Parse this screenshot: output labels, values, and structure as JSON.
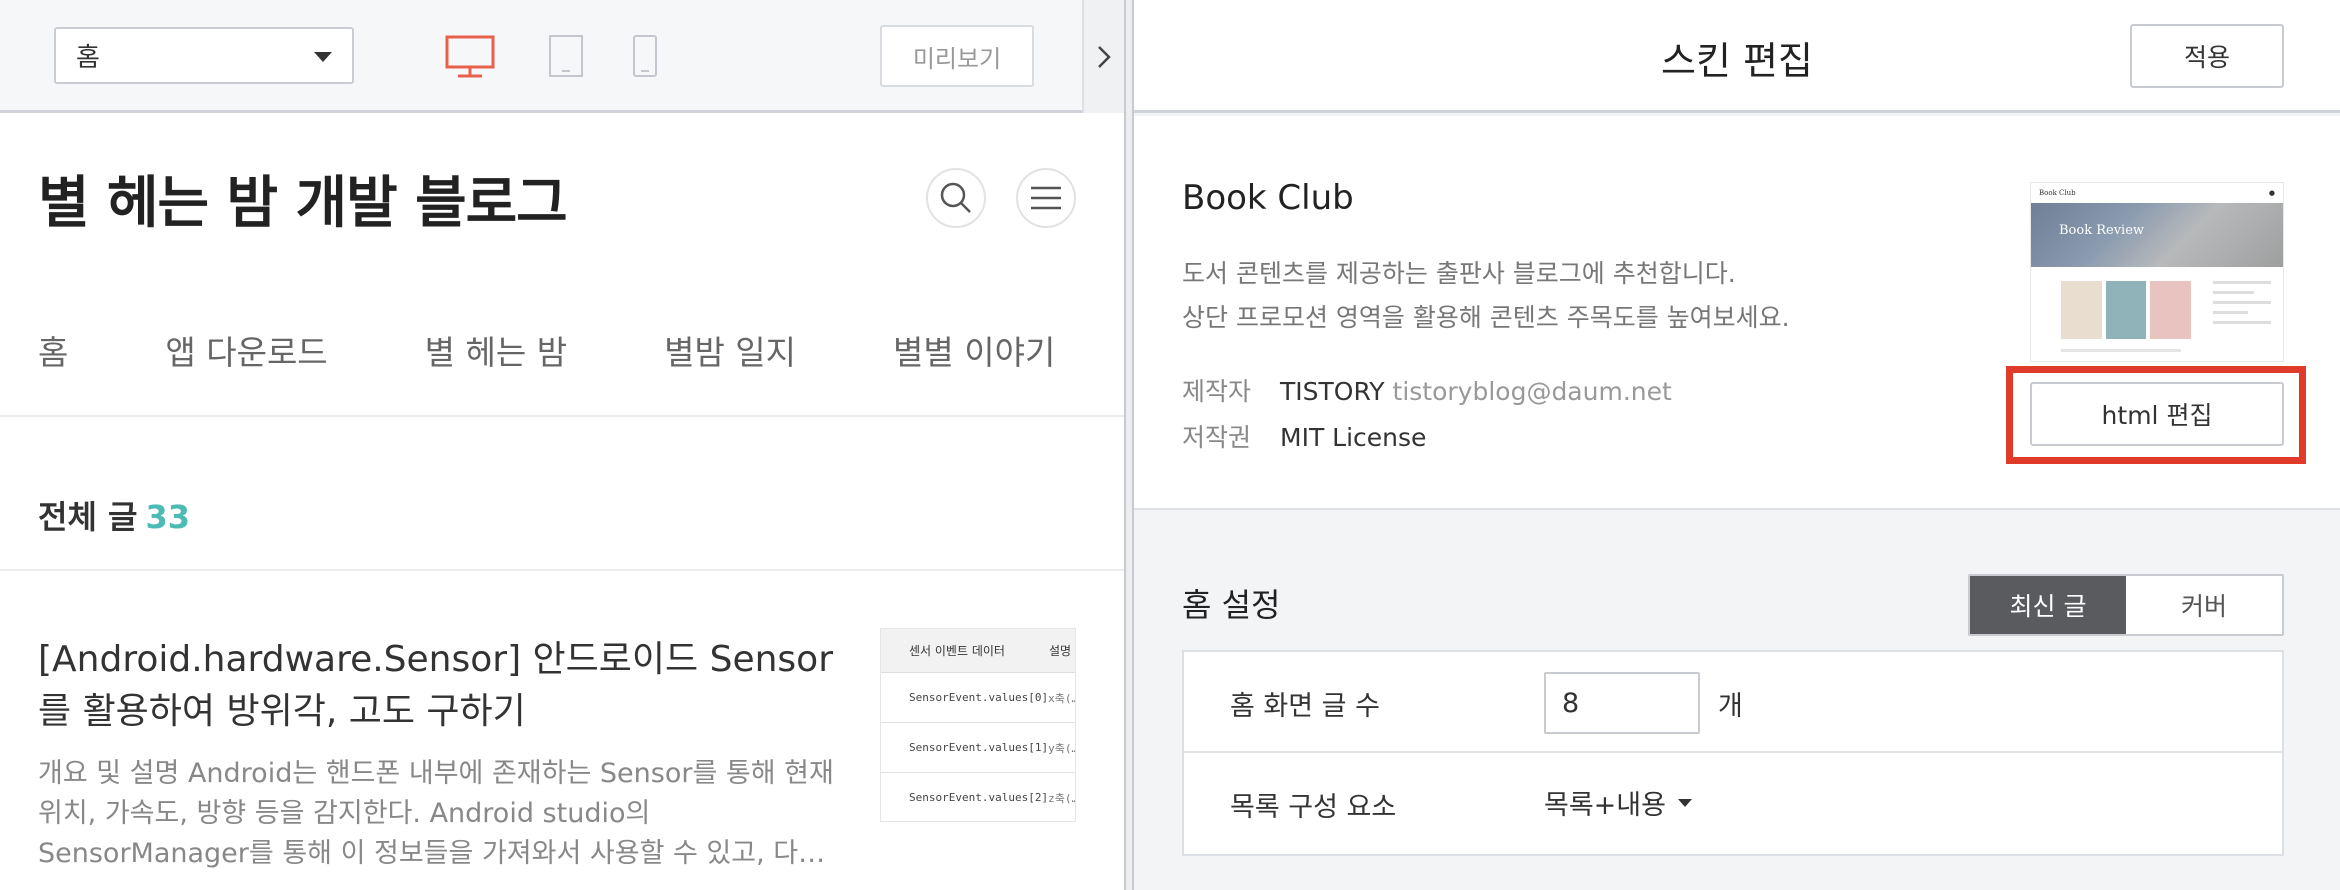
{
  "left": {
    "page_select": "홈",
    "preview_label": "미리보기",
    "blog_title": "별 헤는 밤 개발 블로그",
    "nav": [
      "홈",
      "앱 다운로드",
      "별 헤는 밤",
      "별밤 일지",
      "별별 이야기"
    ],
    "total_label": "전체 글",
    "total_count": "33",
    "post": {
      "title": "[Android.hardware.Sensor] 안드로이드 Sensor를 활용하여 방위각, 고도 구하기",
      "excerpt": "개요 및 설명 Android는 핸드폰 내부에 존재하는 Sensor를 통해 현재 위치, 가속도, 방향 등을 감지한다. Android studio의 SensorManager를 통해 이 정보들을 가져와서 사용할 수 있고, 다…",
      "thumb": {
        "headers": [
          "센서 이벤트 데이터",
          "설명"
        ],
        "rows": [
          {
            "key": "SensorEvent.values[0]",
            "desc": "x축(…"
          },
          {
            "key": "SensorEvent.values[1]",
            "desc": "y축(…"
          },
          {
            "key": "SensorEvent.values[2]",
            "desc": "z축(…"
          }
        ]
      }
    }
  },
  "right": {
    "title": "스킨 편집",
    "apply_label": "적용",
    "skin": {
      "name": "Book Club",
      "desc_line1": "도서 콘텐츠를 제공하는 출판사 블로그에 추천합니다.",
      "desc_line2": "상단 프로모션 영역을 활용해 콘텐츠 주목도를 높여보세요.",
      "maker_label": "제작자",
      "maker": "TISTORY",
      "maker_email": "tistoryblog@daum.net",
      "license_label": "저작권",
      "license": "MIT License",
      "thumb_site": "Book Club",
      "thumb_banner": "Book Review",
      "html_edit_label": "html 편집"
    },
    "home": {
      "label": "홈 설정",
      "tabs": [
        "최신 글",
        "커버"
      ],
      "post_count_label": "홈 화면 글 수",
      "post_count_value": "8",
      "post_count_unit": "개",
      "list_label": "목록 구성 요소",
      "list_value": "목록+내용"
    }
  },
  "colors": {
    "accent_teal": "#4bbbb4",
    "highlight_red": "#e03a28",
    "desktop_icon": "#e8604c"
  },
  "icons": [
    "monitor-icon",
    "tablet-icon",
    "phone-icon",
    "search-icon",
    "hamburger-icon",
    "chevron-right-icon",
    "caret-down-icon"
  ]
}
